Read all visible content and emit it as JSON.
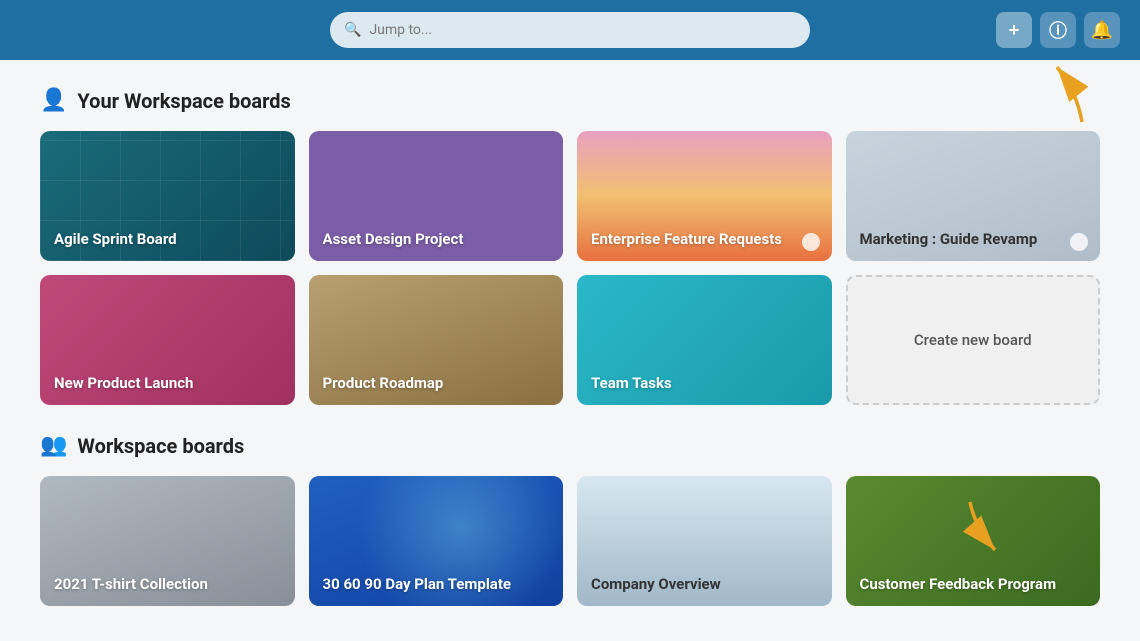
{
  "header": {
    "search_placeholder": "Jump to...",
    "add_label": "+",
    "info_label": "ⓘ",
    "bell_label": "🔔"
  },
  "workspace_section": {
    "title": "Your Workspace boards",
    "icon": "👤"
  },
  "workspace_boards": [
    {
      "id": "agile",
      "title": "Agile Sprint Board",
      "bg": "agile"
    },
    {
      "id": "asset",
      "title": "Asset Design Project",
      "bg": "asset"
    },
    {
      "id": "enterprise",
      "title": "Enterprise Feature Requests",
      "bg": "enterprise"
    },
    {
      "id": "marketing",
      "title": "Marketing : Guide Revamp",
      "bg": "marketing"
    },
    {
      "id": "new-product",
      "title": "New Product Launch",
      "bg": "new-product"
    },
    {
      "id": "product-roadmap",
      "title": "Product Roadmap",
      "bg": "product-roadmap"
    },
    {
      "id": "team-tasks",
      "title": "Team Tasks",
      "bg": "team-tasks"
    },
    {
      "id": "create",
      "title": "Create new board",
      "bg": "create"
    }
  ],
  "workspace_section2": {
    "title": "Workspace boards",
    "icon": "👥"
  },
  "workspace_boards2": [
    {
      "id": "tshirt",
      "title": "2021 T-shirt Collection",
      "bg": "tshirt"
    },
    {
      "id": "30-60-90",
      "title": "30 60 90 Day Plan Template",
      "bg": "30-60-90"
    },
    {
      "id": "company",
      "title": "Company Overview",
      "bg": "company"
    },
    {
      "id": "customer",
      "title": "Customer Feedback Program",
      "bg": "customer"
    }
  ]
}
